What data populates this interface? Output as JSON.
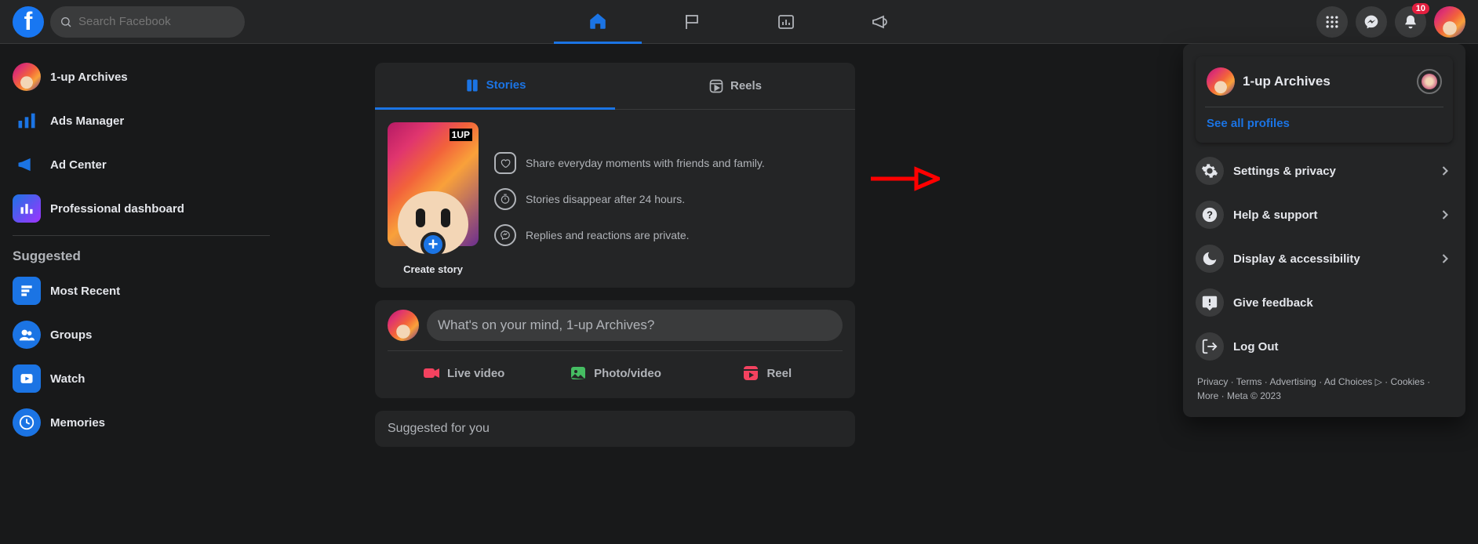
{
  "search": {
    "placeholder": "Search Facebook"
  },
  "notifications": {
    "count": "10"
  },
  "profile_name": "1-up Archives",
  "left_sidebar": {
    "items": [
      {
        "label": "1-up Archives"
      },
      {
        "label": "Ads Manager"
      },
      {
        "label": "Ad Center"
      },
      {
        "label": "Professional dashboard"
      }
    ],
    "suggested_heading": "Suggested",
    "suggested_items": [
      {
        "label": "Most Recent"
      },
      {
        "label": "Groups"
      },
      {
        "label": "Watch"
      },
      {
        "label": "Memories"
      }
    ]
  },
  "stories": {
    "tab_stories": "Stories",
    "tab_reels": "Reels",
    "create_label": "Create story",
    "info1": "Share everyday moments with friends and family.",
    "info2": "Stories disappear after 24 hours.",
    "info3": "Replies and reactions are private."
  },
  "composer": {
    "placeholder": "What's on your mind, 1-up Archives?",
    "live": "Live video",
    "photo": "Photo/video",
    "reel": "Reel"
  },
  "suggested_for_you": "Suggested for you",
  "dropdown": {
    "profile_name": "1-up Archives",
    "see_all": "See all profiles",
    "settings": "Settings & privacy",
    "help": "Help & support",
    "display": "Display & accessibility",
    "feedback": "Give feedback",
    "logout": "Log Out",
    "footer": {
      "privacy": "Privacy",
      "terms": "Terms",
      "advertising": "Advertising",
      "adchoices": "Ad Choices",
      "cookies": "Cookies",
      "more": "More",
      "meta": "Meta © 2023"
    }
  }
}
